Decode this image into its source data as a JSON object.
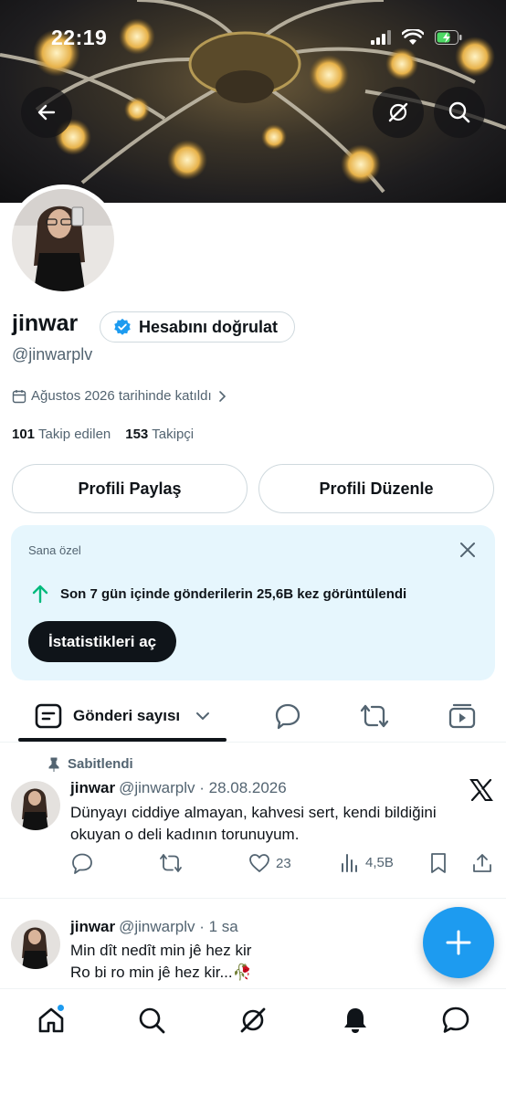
{
  "status_bar": {
    "time": "22:19"
  },
  "profile": {
    "name": "jinwar",
    "verify_label": "Hesabını doğrulat",
    "handle": "@jinwarplv",
    "joined": "Ağustos 2026 tarihinde katıldı",
    "following_count": "101",
    "following_label": "Takip edilen",
    "followers_count": "153",
    "followers_label": "Takipçi",
    "share_label": "Profili Paylaş",
    "edit_label": "Profili Düzenle"
  },
  "insight_card": {
    "tag": "Sana özel",
    "message": "Son 7 gün içinde gönderilerin 25,6B kez görüntülendi",
    "button_label": "İstatistikleri aç"
  },
  "tabs": {
    "active_label": "Gönderi sayısı",
    "icons": [
      "chat-bubble-icon",
      "repost-icon",
      "video-icon"
    ]
  },
  "posts": [
    {
      "pinned_label": "Sabitlendi",
      "name": "jinwar",
      "meta": "@jinwarplv · 28.08.2026",
      "text": "Dünyayı ciddiye almayan, kahvesi sert, kendi bildiğini okuyan o deli kadının torunuyum.",
      "likes": "23",
      "views": "4,5B"
    },
    {
      "name": "jinwar",
      "meta": "@jinwarplv · 1 sa",
      "line1": "Min dît nedît min jê hez kir",
      "line2": "Ro bi ro min jê hez kir...🥀"
    }
  ],
  "colors": {
    "accent": "#1d9bf0",
    "text": "#0f1419",
    "secondary": "#536471",
    "card_bg": "#e6f6fd",
    "green_arrow": "#00ba7c"
  }
}
